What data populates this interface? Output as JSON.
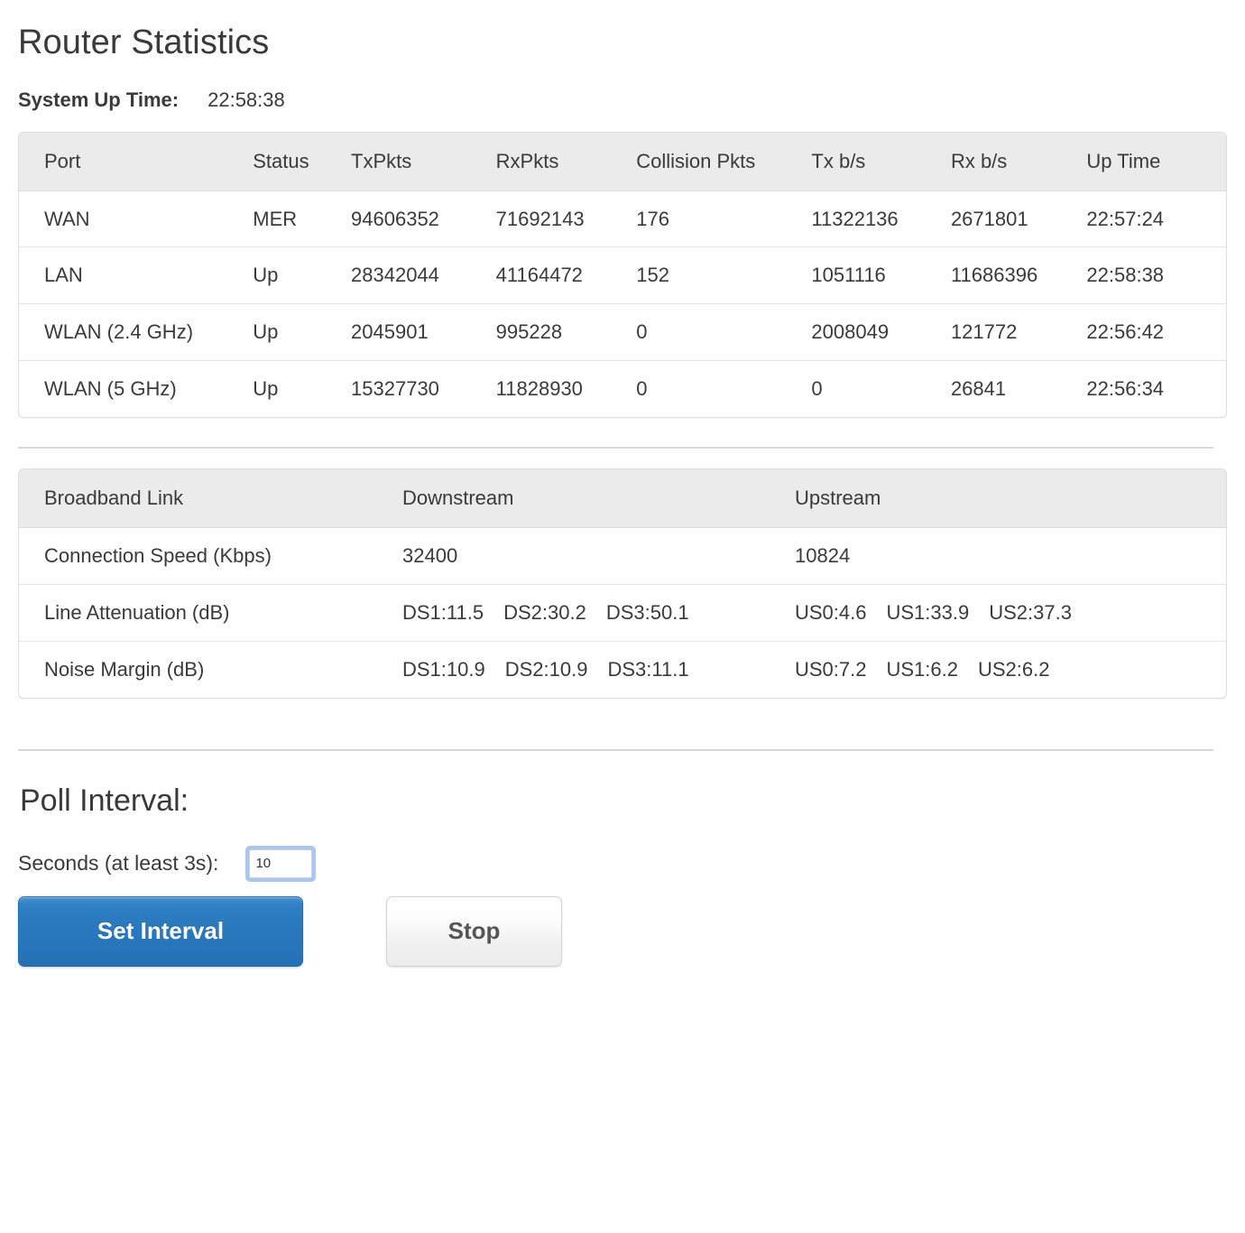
{
  "page": {
    "title": "Router Statistics"
  },
  "uptime": {
    "label": "System Up Time:",
    "value": "22:58:38"
  },
  "port_table": {
    "headers": {
      "port": "Port",
      "status": "Status",
      "txpkts": "TxPkts",
      "rxpkts": "RxPkts",
      "collision": "Collision Pkts",
      "txbs": "Tx b/s",
      "rxbs": "Rx b/s",
      "uptime": "Up Time"
    },
    "rows": [
      {
        "port": "WAN",
        "status": "MER",
        "txpkts": "94606352",
        "rxpkts": "71692143",
        "collision": "176",
        "txbs": "11322136",
        "rxbs": "2671801",
        "uptime": "22:57:24"
      },
      {
        "port": "LAN",
        "status": "Up",
        "txpkts": "28342044",
        "rxpkts": "41164472",
        "collision": "152",
        "txbs": "1051116",
        "rxbs": "11686396",
        "uptime": "22:58:38"
      },
      {
        "port": "WLAN (2.4 GHz)",
        "status": "Up",
        "txpkts": "2045901",
        "rxpkts": "995228",
        "collision": "0",
        "txbs": "2008049",
        "rxbs": "121772",
        "uptime": "22:56:42"
      },
      {
        "port": "WLAN (5 GHz)",
        "status": "Up",
        "txpkts": "15327730",
        "rxpkts": "11828930",
        "collision": "0",
        "txbs": "0",
        "rxbs": "26841",
        "uptime": "22:56:34"
      }
    ]
  },
  "broadband_table": {
    "headers": {
      "name": "Broadband Link",
      "downstream": "Downstream",
      "upstream": "Upstream"
    },
    "rows": [
      {
        "name": "Connection Speed (Kbps)",
        "downstream": [
          "32400"
        ],
        "upstream": [
          "10824"
        ]
      },
      {
        "name": "Line Attenuation (dB)",
        "downstream": [
          "DS1:11.5",
          "DS2:30.2",
          "DS3:50.1"
        ],
        "upstream": [
          "US0:4.6",
          "US1:33.9",
          "US2:37.3"
        ]
      },
      {
        "name": "Noise Margin (dB)",
        "downstream": [
          "DS1:10.9",
          "DS2:10.9",
          "DS3:11.1"
        ],
        "upstream": [
          "US0:7.2",
          "US1:6.2",
          "US2:6.2"
        ]
      }
    ]
  },
  "poll": {
    "title": "Poll Interval:",
    "seconds_label": "Seconds (at least 3s):",
    "seconds_value": "10",
    "set_button": "Set Interval",
    "stop_button": "Stop"
  },
  "colors": {
    "primary_button": "#2a78bd",
    "header_background": "#ebebeb",
    "text": "#3a3a3a",
    "input_focus_ring": "#a8c7f0"
  }
}
